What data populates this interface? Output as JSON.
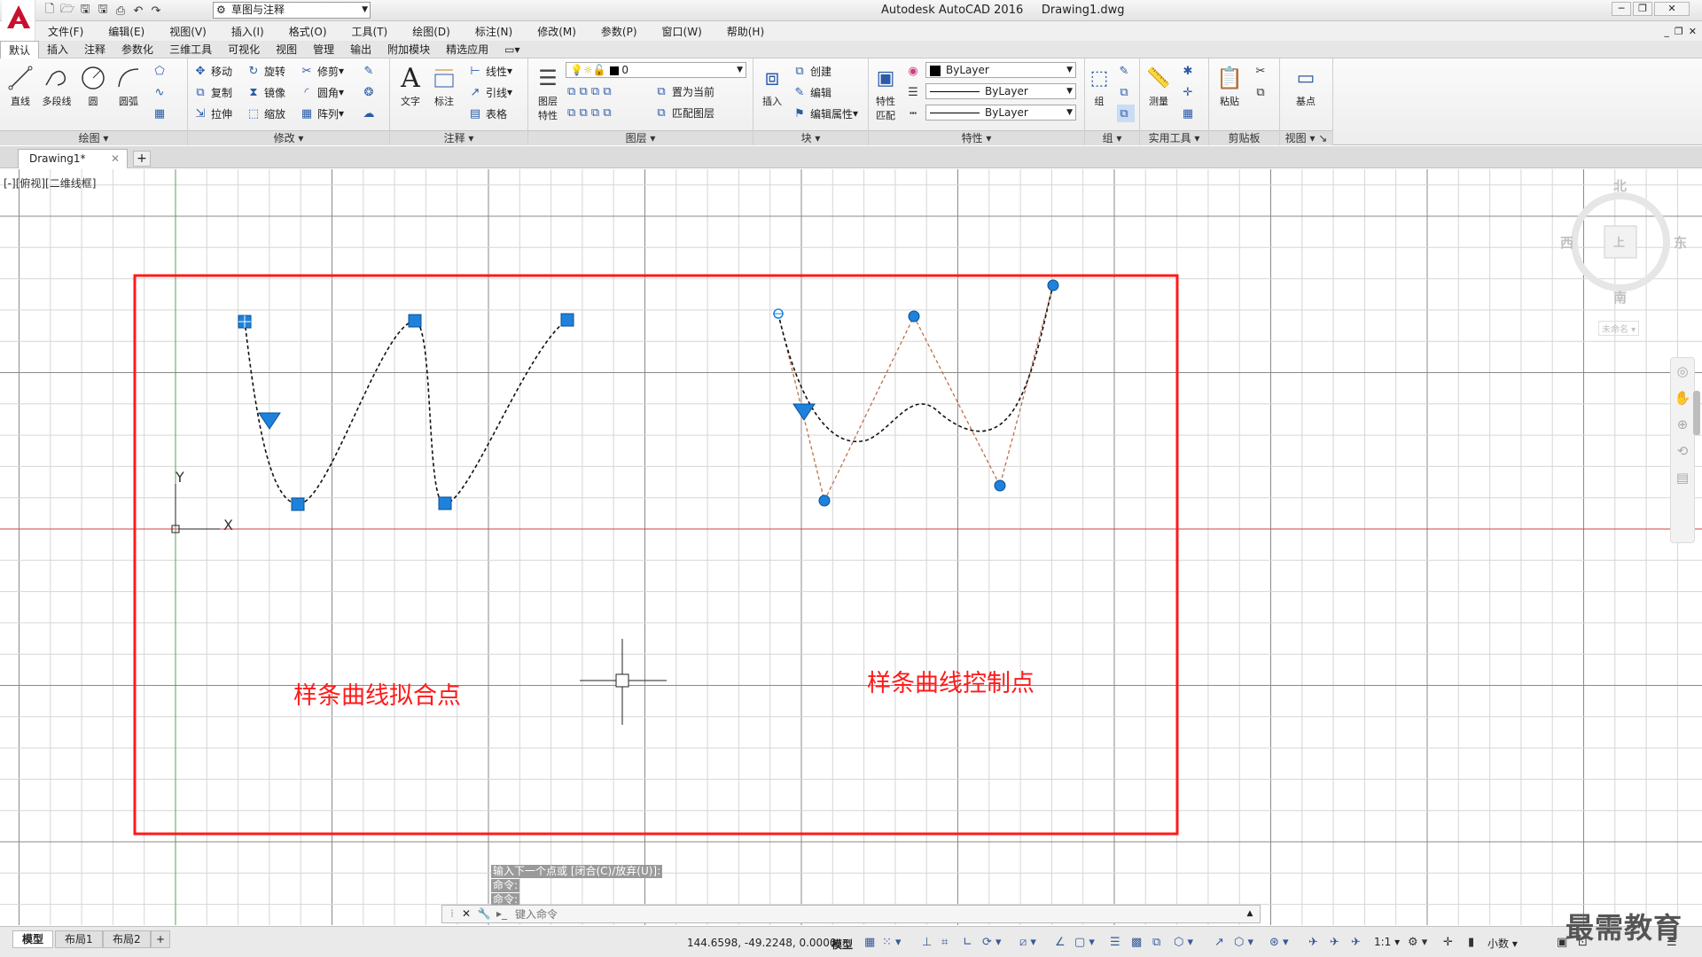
{
  "title_bar": {
    "app_title": "Autodesk AutoCAD 2016",
    "file_name": "Drawing1.dwg",
    "workspace": "草图与注释"
  },
  "menu": [
    "文件(F)",
    "编辑(E)",
    "视图(V)",
    "插入(I)",
    "格式(O)",
    "工具(T)",
    "绘图(D)",
    "标注(N)",
    "修改(M)",
    "参数(P)",
    "窗口(W)",
    "帮助(H)"
  ],
  "ribbon_tabs": [
    "默认",
    "插入",
    "注释",
    "参数化",
    "三维工具",
    "可视化",
    "视图",
    "管理",
    "输出",
    "附加模块",
    "精选应用"
  ],
  "draw_panel": {
    "title": "绘图",
    "line": "直线",
    "polyline": "多段线",
    "circle": "圆",
    "arc": "圆弧"
  },
  "modify_panel": {
    "title": "修改",
    "move": "移动",
    "rotate": "旋转",
    "trim": "修剪",
    "copy": "复制",
    "mirror": "镜像",
    "fillet": "圆角",
    "stretch": "拉伸",
    "scale": "缩放",
    "array": "阵列"
  },
  "annotation_panel": {
    "title": "注释",
    "text": "文字",
    "dimension": "标注",
    "linear": "线性",
    "leader": "引线",
    "table": "表格"
  },
  "layers_panel": {
    "title": "图层",
    "layer_props_1": "图层",
    "layer_props_2": "特性",
    "current_layer": "0",
    "make_current": "置为当前",
    "match_layer": "匹配图层"
  },
  "block_panel": {
    "title": "块",
    "insert": "插入",
    "create": "创建",
    "edit": "编辑",
    "edit_attr": "编辑属性"
  },
  "properties_panel": {
    "title": "特性",
    "match_1": "特性",
    "match_2": "匹配",
    "color": "ByLayer",
    "linetype": "ByLayer",
    "lineweight": "ByLayer"
  },
  "groups_panel": {
    "title": "组",
    "group": "组"
  },
  "utilities_panel": {
    "title": "实用工具",
    "measure": "测量"
  },
  "clipboard_panel": {
    "title": "剪贴板",
    "paste": "粘贴"
  },
  "view_panel": {
    "title": "视图",
    "base": "基点"
  },
  "doc_tab": {
    "name": "Drawing1*"
  },
  "canvas": {
    "view_label": "[-][俯视][二维线框]",
    "label_fit": "样条曲线拟合点",
    "label_cv": "样条曲线控制点",
    "ucs_x": "X",
    "ucs_y": "Y"
  },
  "viewcube": {
    "north": "北",
    "south": "南",
    "east": "东",
    "west": "西",
    "top": "上",
    "wcs": "未命名"
  },
  "command": {
    "history": [
      "输入下一个点或 [闭合(C)/放弃(U)]:",
      "命令:",
      "命令:"
    ],
    "placeholder": "键入命令"
  },
  "status": {
    "layout_tabs": [
      "模型",
      "布局1",
      "布局2"
    ],
    "coords": "144.6598, -49.2248, 0.0000",
    "model": "模型",
    "scale": "1:1",
    "units": "小数"
  },
  "watermark": "最需教育",
  "colors": {
    "accent": "#1e82dc",
    "red": "#ff1a1a",
    "grid_minor": "#d6d6d6",
    "grid_major": "#8a8a8a",
    "cv_line": "#c0704a"
  }
}
